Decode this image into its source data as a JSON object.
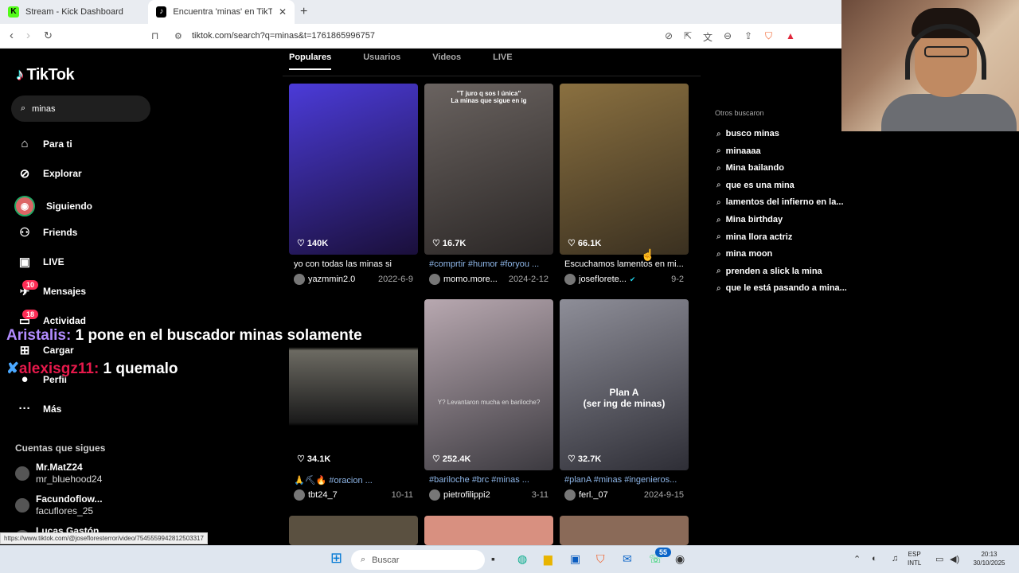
{
  "browser": {
    "tabs": [
      {
        "title": "Stream - Kick Dashboard",
        "favicon": "K"
      },
      {
        "title": "Encuentra 'minas' en TikTok | Bu",
        "favicon": "♪"
      }
    ],
    "url": "tiktok.com/search?q=minas&t=1761865996757",
    "status_url": "https://www.tiktok.com/@josefloresterror/video/7545559942812503317"
  },
  "sidebar": {
    "logo": "TikTok",
    "search_value": "minas",
    "items": [
      {
        "label": "Para ti",
        "icon": "home-icon",
        "glyph": "⌂"
      },
      {
        "label": "Explorar",
        "icon": "compass-icon",
        "glyph": "⊘"
      },
      {
        "label": "Siguiendo",
        "icon": "following-avatar-icon",
        "glyph": "◉"
      },
      {
        "label": "Friends",
        "icon": "friends-icon",
        "glyph": "⚇"
      },
      {
        "label": "LIVE",
        "icon": "live-icon",
        "glyph": "▣"
      },
      {
        "label": "Mensajes",
        "icon": "messages-icon",
        "glyph": "✈",
        "badge": "10"
      },
      {
        "label": "Actividad",
        "icon": "activity-icon",
        "glyph": "▭",
        "badge": "18"
      },
      {
        "label": "Cargar",
        "icon": "upload-icon",
        "glyph": "⊞"
      },
      {
        "label": "Perfil",
        "icon": "profile-icon",
        "glyph": "●"
      },
      {
        "label": "Más",
        "icon": "more-icon",
        "glyph": "···"
      }
    ],
    "following_title": "Cuentas que sigues",
    "following": [
      {
        "name": "Mr.MatZ24",
        "handle": "mr_bluehood24"
      },
      {
        "name": "Facundoflow...",
        "handle": "facuflores_25"
      },
      {
        "name": "Lucas Gastón",
        "handle": ""
      }
    ]
  },
  "tabs": [
    "Populares",
    "Usuarios",
    "Videos",
    "LIVE"
  ],
  "videos": [
    {
      "likes": "140K",
      "desc": "yo con todas las minas si",
      "user": "yazmmin2.0",
      "date": "2022-6-9",
      "overlay": "",
      "colors": [
        "#1a0f3a",
        "#4b3bd8"
      ]
    },
    {
      "likes": "16.7K",
      "desc": "#comprtir #humor #foryou ...",
      "user": "momo.more...",
      "date": "2024-2-12",
      "overlay": "\"T juro q sos l única\"\nLa minas que sigue en ig",
      "colors": [
        "#2a2625",
        "#6a6360"
      ]
    },
    {
      "likes": "66.1K",
      "desc": "Escuchamos lamentos en mi...",
      "user": "joseflorete...",
      "date": "9-2",
      "overlay": "",
      "colors": [
        "#3a3020",
        "#8a7040"
      ]
    },
    {
      "likes": "34.1K",
      "desc": "🙏⛏🔥 #oracion ...",
      "user": "tbt24_7",
      "date": "10-11",
      "overlay": "",
      "colors": [
        "#1a1a1a",
        "#6c6a62"
      ]
    },
    {
      "likes": "252.4K",
      "desc": "#bariloche #brc #minas ...",
      "user": "pietrofilippi2",
      "date": "3-11",
      "overlay": "Y? Levantaron mucha en bariloche?",
      "colors": [
        "#3c3a40",
        "#b8a8b0"
      ]
    },
    {
      "likes": "32.7K",
      "desc": "#planA #minas #ingenieros...",
      "user": "ferl._07",
      "date": "2024-9-15",
      "overlay": "Plan A\n(ser ing de minas)",
      "colors": [
        "#2e2e36",
        "#8e8e98"
      ]
    }
  ],
  "others": {
    "title": "Otros buscaron",
    "items": [
      "busco minas",
      "minaaaa",
      "Mina bailando",
      "que es una mina",
      "lamentos del infierno en la...",
      "Mina birthday",
      "mina llora actriz",
      "mina moon",
      "prenden a slick la mina",
      "que le está pasando a mina..."
    ]
  },
  "chat": [
    {
      "user": "Aristalis:",
      "msg": "1 pone en el buscador minas solamente",
      "color": "#b28cff"
    },
    {
      "user": "alexisgz11:",
      "msg": "1 quemalo",
      "color": "#e6194b"
    }
  ],
  "taskbar": {
    "search": "Buscar",
    "lang": "ESP\nINTL",
    "time": "20:13",
    "date": "30/10/2025",
    "badge": "55"
  }
}
